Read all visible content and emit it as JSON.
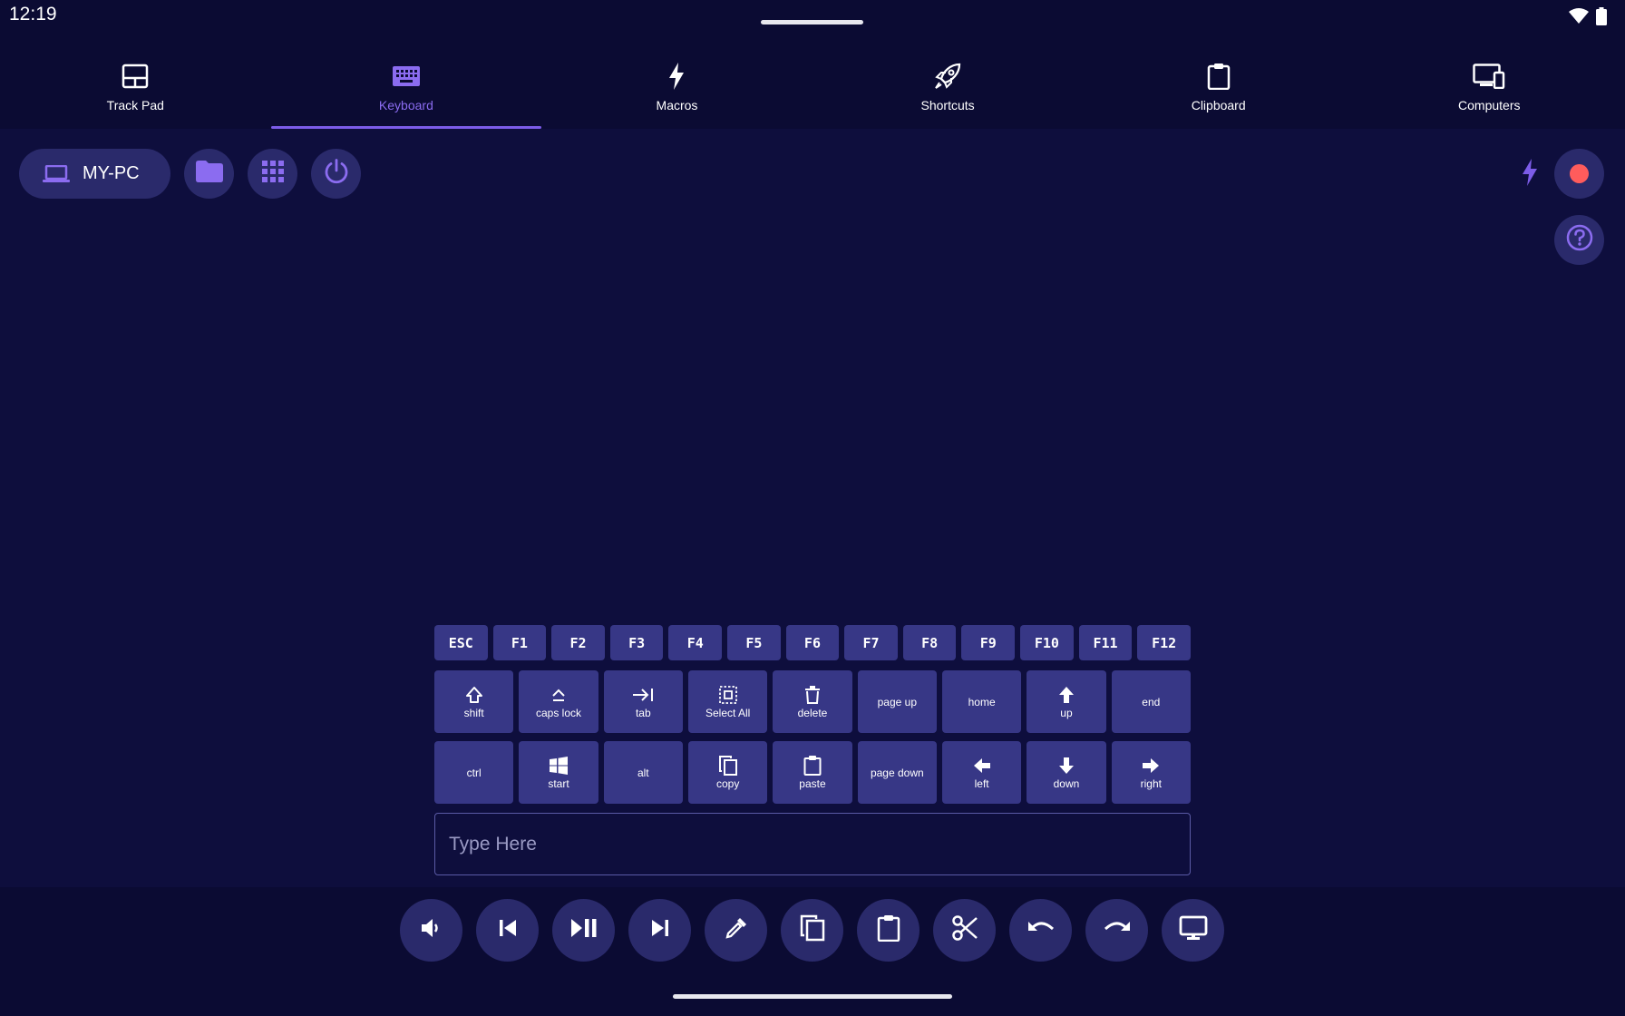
{
  "status": {
    "time": "12:19"
  },
  "tabs": [
    {
      "label": "Track Pad",
      "icon": "trackpad-icon",
      "active": false
    },
    {
      "label": "Keyboard",
      "icon": "keyboard-icon",
      "active": true
    },
    {
      "label": "Macros",
      "icon": "lightning-icon",
      "active": false
    },
    {
      "label": "Shortcuts",
      "icon": "rocket-icon",
      "active": false
    },
    {
      "label": "Clipboard",
      "icon": "clipboard-icon",
      "active": false
    },
    {
      "label": "Computers",
      "icon": "devices-icon",
      "active": false
    }
  ],
  "toolbar": {
    "computer_name": "MY-PC"
  },
  "function_keys": [
    "ESC",
    "F1",
    "F2",
    "F3",
    "F4",
    "F5",
    "F6",
    "F7",
    "F8",
    "F9",
    "F10",
    "F11",
    "F12"
  ],
  "keys_row1": [
    {
      "label": "shift",
      "icon": "shift-icon"
    },
    {
      "label": "caps lock",
      "icon": "caps-lock-icon"
    },
    {
      "label": "tab",
      "icon": "tab-icon"
    },
    {
      "label": "Select All",
      "icon": "select-all-icon"
    },
    {
      "label": "delete",
      "icon": "trash-icon"
    },
    {
      "label": "page up",
      "icon": ""
    },
    {
      "label": "home",
      "icon": ""
    },
    {
      "label": "up",
      "icon": "arrow-up-icon"
    },
    {
      "label": "end",
      "icon": ""
    }
  ],
  "keys_row2": [
    {
      "label": "ctrl",
      "icon": ""
    },
    {
      "label": "start",
      "icon": "windows-icon"
    },
    {
      "label": "alt",
      "icon": ""
    },
    {
      "label": "copy",
      "icon": "copy-icon"
    },
    {
      "label": "paste",
      "icon": "paste-icon"
    },
    {
      "label": "page down",
      "icon": ""
    },
    {
      "label": "left",
      "icon": "arrow-left-icon"
    },
    {
      "label": "down",
      "icon": "arrow-down-icon"
    },
    {
      "label": "right",
      "icon": "arrow-right-icon"
    }
  ],
  "type_input": {
    "placeholder": "Type Here",
    "value": ""
  },
  "media_buttons": [
    "volume-icon",
    "previous-track-icon",
    "play-pause-icon",
    "next-track-icon",
    "eyedropper-icon",
    "copy-icon",
    "paste-icon",
    "cut-icon",
    "undo-icon",
    "redo-icon",
    "monitor-icon"
  ],
  "colors": {
    "background": "#0e0e3d",
    "bar": "#0b0b33",
    "key": "#373786",
    "button": "#2a2a6b",
    "accent": "#7c5ce8",
    "record": "#ff5c5c"
  }
}
